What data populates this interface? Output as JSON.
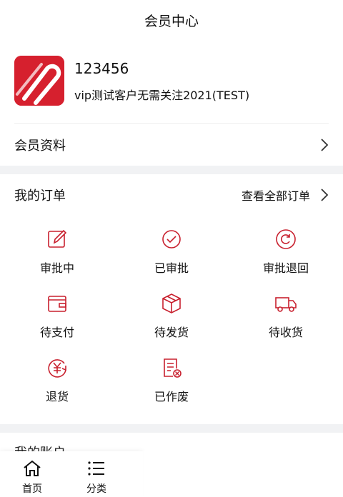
{
  "header": {
    "title": "会员中心"
  },
  "profile": {
    "username": "123456",
    "company": "vip测试客户无需关注2021(TEST)"
  },
  "menu": {
    "member_info_label": "会员资料"
  },
  "orders": {
    "title": "我的订单",
    "view_all_label": "查看全部订单",
    "statuses": [
      {
        "label": "审批中",
        "icon": "edit-icon"
      },
      {
        "label": "已审批",
        "icon": "check-circle-icon"
      },
      {
        "label": "审批退回",
        "icon": "return-circle-icon"
      },
      {
        "label": "待支付",
        "icon": "wallet-icon"
      },
      {
        "label": "待发货",
        "icon": "box-icon"
      },
      {
        "label": "待收货",
        "icon": "truck-icon"
      },
      {
        "label": "退货",
        "icon": "yen-refund-icon"
      },
      {
        "label": "已作废",
        "icon": "void-document-icon"
      }
    ]
  },
  "account": {
    "title": "我的账户"
  },
  "tabbar": {
    "items": [
      {
        "label": "首页",
        "icon": "home-icon"
      },
      {
        "label": "分类",
        "icon": "list-icon"
      }
    ]
  },
  "colors": {
    "accent": "#c8202e",
    "logo_bg": "#d6202e",
    "section_gap": "#f1f2f4"
  }
}
